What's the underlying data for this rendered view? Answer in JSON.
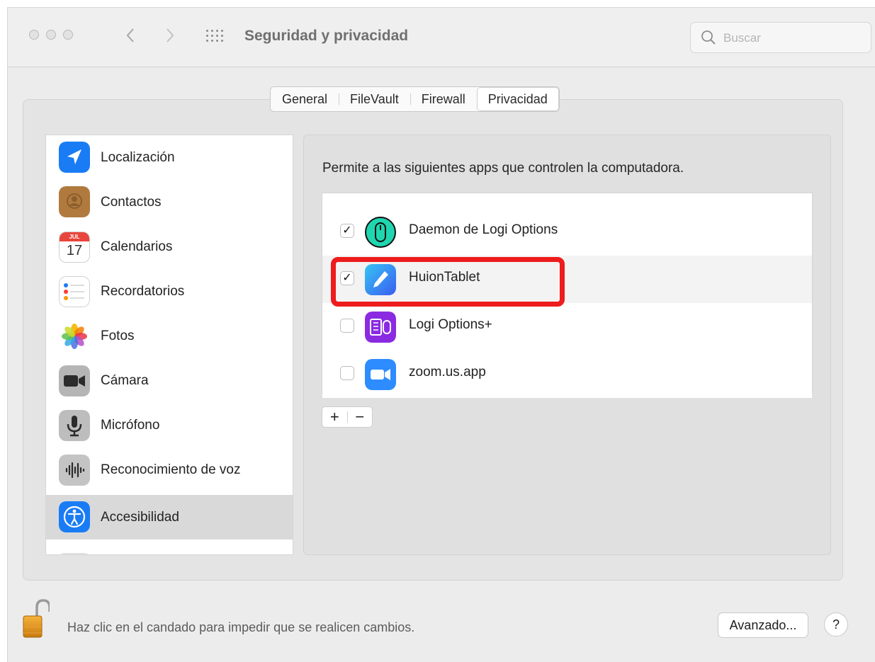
{
  "window": {
    "title": "Seguridad y privacidad"
  },
  "search": {
    "placeholder": "Buscar"
  },
  "tabs": [
    {
      "label": "General",
      "active": false
    },
    {
      "label": "FileVault",
      "active": false
    },
    {
      "label": "Firewall",
      "active": false
    },
    {
      "label": "Privacidad",
      "active": true
    }
  ],
  "sidebar": {
    "items": [
      {
        "label": "Localización",
        "icon": "location-arrow-icon"
      },
      {
        "label": "Contactos",
        "icon": "contacts-icon"
      },
      {
        "label": "Calendarios",
        "icon": "calendar-icon",
        "calendar_month": "JUL",
        "calendar_day": "17"
      },
      {
        "label": "Recordatorios",
        "icon": "reminders-icon"
      },
      {
        "label": "Fotos",
        "icon": "photos-icon"
      },
      {
        "label": "Cámara",
        "icon": "camera-icon"
      },
      {
        "label": "Micrófono",
        "icon": "microphone-icon"
      },
      {
        "label": "Reconocimiento de voz",
        "icon": "voice-waveform-icon"
      },
      {
        "label": "Accesibilidad",
        "icon": "accessibility-icon",
        "selected": true
      }
    ]
  },
  "main": {
    "description": "Permite a las siguientes apps que controlen la computadora.",
    "apps": [
      {
        "name": "Daemon de Logi Options",
        "checked": true,
        "icon": "logi-mouse-icon"
      },
      {
        "name": "HuionTablet",
        "checked": true,
        "icon": "huion-pen-icon",
        "highlighted": true
      },
      {
        "name": "Logi Options+",
        "checked": false,
        "icon": "logi-options-plus-icon"
      },
      {
        "name": "zoom.us.app",
        "checked": false,
        "icon": "zoom-camera-icon"
      }
    ],
    "add_label": "+",
    "remove_label": "−"
  },
  "footer": {
    "lock_text": "Haz clic en el candado para impedir que se realicen cambios.",
    "advanced_label": "Avanzado...",
    "help_label": "?"
  },
  "colors": {
    "highlight": "#ee1c1c",
    "accent_blue": "#1a7cf5",
    "selected_row": "#d9d9d9"
  }
}
